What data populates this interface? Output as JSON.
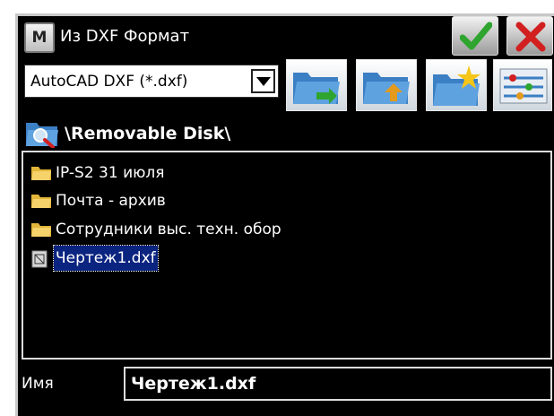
{
  "window": {
    "app_icon_letter": "M",
    "title": "Из DXF Формат"
  },
  "toolbar": {
    "format_select_value": "AutoCAD DXF (*.dxf)",
    "accent_ok": "#2fa52f",
    "accent_close": "#d21f1f"
  },
  "location": {
    "path": "\\Removable Disk\\"
  },
  "files": [
    {
      "name": "IP-S2 31 июля",
      "type": "folder"
    },
    {
      "name": "Почта - архив",
      "type": "folder"
    },
    {
      "name": "Сотрудники выс. техн. обор",
      "type": "folder"
    },
    {
      "name": "Чертеж1.dxf",
      "type": "file",
      "selected": true
    }
  ],
  "name_row": {
    "label": "Имя",
    "value": "Чертеж1.dxf"
  }
}
